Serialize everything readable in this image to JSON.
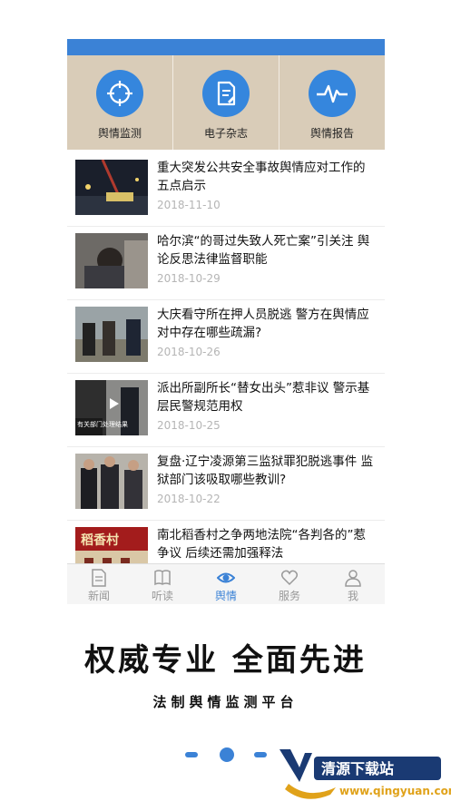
{
  "features": [
    {
      "label": "舆情监测",
      "icon": "target-icon"
    },
    {
      "label": "电子杂志",
      "icon": "document-edit-icon"
    },
    {
      "label": "舆情报告",
      "icon": "pulse-icon"
    }
  ],
  "articles": [
    {
      "title": "重大突发公共安全事故舆情应对工作的五点启示",
      "date": "2018-11-10"
    },
    {
      "title": "哈尔滨“的哥过失致人死亡案”引关注 舆论反思法律监督职能",
      "date": "2018-10-29"
    },
    {
      "title": "大庆看守所在押人员脱逃 警方在舆情应对中存在哪些疏漏?",
      "date": "2018-10-26"
    },
    {
      "title": "派出所副所长“替女出头”惹非议 警示基层民警规范用权",
      "date": "2018-10-25",
      "thumb_caption": "有关部门处理结果"
    },
    {
      "title": "复盘·辽宁凌源第三监狱罪犯脱逃事件 监狱部门该吸取哪些教训?",
      "date": "2018-10-22"
    },
    {
      "title": "南北稻香村之争两地法院“各判各的”惹争议 后续还需加强释法",
      "date": "",
      "thumb_caption": "稻香村"
    }
  ],
  "tabs": [
    {
      "label": "新闻",
      "icon": "news-icon",
      "active": false
    },
    {
      "label": "听读",
      "icon": "book-icon",
      "active": false
    },
    {
      "label": "舆情",
      "icon": "eye-icon",
      "active": true
    },
    {
      "label": "服务",
      "icon": "heart-icon",
      "active": false
    },
    {
      "label": "我",
      "icon": "person-icon",
      "active": false
    }
  ],
  "slogan": "权威专业 全面先进",
  "subslogan": "法制舆情监测平台",
  "carousel": {
    "page_count": 3,
    "active_index": 1
  },
  "watermark": {
    "name": "清源下载站",
    "domain": "www.qingyuan.com"
  },
  "colors": {
    "accent": "#3b82d6",
    "feature_bg": "#d9ccb8"
  }
}
